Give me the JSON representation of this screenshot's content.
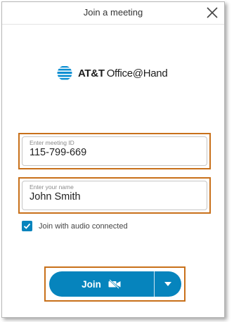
{
  "window": {
    "title": "Join a meeting"
  },
  "branding": {
    "brand_bold": "AT&T",
    "brand_regular": "Office@Hand"
  },
  "form": {
    "meeting_id": {
      "label": "Enter meeting ID",
      "value": "115-799-669"
    },
    "name": {
      "label": "Enter your name",
      "value": "John Smith"
    },
    "audio_checkbox": {
      "label": "Join with audio connected",
      "checked": true
    }
  },
  "actions": {
    "join_label": "Join"
  },
  "colors": {
    "accent": "#0684bd",
    "highlight": "#c8701a"
  },
  "icons": {
    "close": "close-icon",
    "brand": "att-globe-icon",
    "checkbox": "checkmark-icon",
    "video_off": "video-off-icon",
    "dropdown": "caret-down-icon"
  }
}
